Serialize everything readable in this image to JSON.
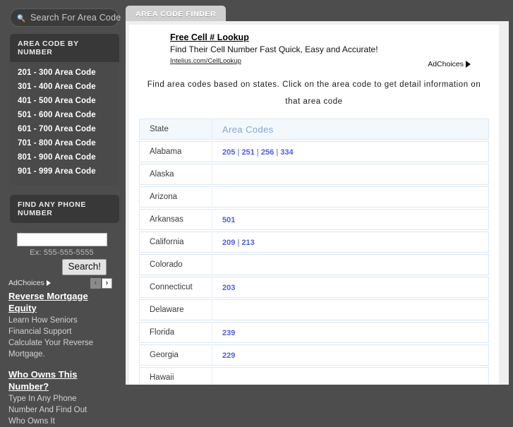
{
  "sidebar": {
    "search": {
      "icon": "search-icon",
      "placeholder": "Search For Area Code",
      "value": ""
    },
    "area_code_panel": {
      "title": "AREA CODE BY NUMBER",
      "items": [
        "201 - 300 Area Code",
        "301 - 400 Area Code",
        "401 - 500 Area Code",
        "501 - 600 Area Code",
        "601 - 700 Area Code",
        "701 - 800 Area Code",
        "801 - 900 Area Code",
        "901 - 999 Area Code"
      ]
    },
    "phone_panel": {
      "title": "FIND ANY PHONE NUMBER",
      "input_value": "",
      "hint": "Ex: 555-555-5555",
      "button_label": "Search!"
    },
    "ad_controls": {
      "adchoices_label": "AdChoices",
      "prev_label": "‹",
      "next_label": "›"
    },
    "ads": [
      {
        "title": "Reverse Mortgage Equity",
        "lines": [
          "Learn How Seniors",
          "Financial Support",
          "Calculate Your Reverse",
          "Mortgage."
        ]
      },
      {
        "title": "Who Owns This Number?",
        "lines": [
          "Type In Any Phone",
          "Number And Find Out",
          "Who Owns It"
        ]
      }
    ]
  },
  "main": {
    "tab_label": "AREA CODE FINDER",
    "ad": {
      "title": "Free Cell # Lookup",
      "description": "Find Their Cell Number Fast Quick, Easy and Accurate!",
      "url": "Intelius.com/CellLookup",
      "adchoices_label": "AdChoices"
    },
    "intro": "Find area codes based on states. Click on the area code to get detail information on that area code",
    "table": {
      "headers": [
        "State",
        "Area Codes"
      ],
      "rows": [
        {
          "state": "Alabama",
          "codes": [
            "205",
            "251",
            "256",
            "334"
          ]
        },
        {
          "state": "Alaska",
          "codes": []
        },
        {
          "state": "Arizona",
          "codes": []
        },
        {
          "state": "Arkansas",
          "codes": [
            "501"
          ]
        },
        {
          "state": "California",
          "codes": [
            "209",
            "213"
          ]
        },
        {
          "state": "Colorado",
          "codes": []
        },
        {
          "state": "Connecticut",
          "codes": [
            "203"
          ]
        },
        {
          "state": "Delaware",
          "codes": []
        },
        {
          "state": "Florida",
          "codes": [
            "239"
          ]
        },
        {
          "state": "Georgia",
          "codes": [
            "229"
          ]
        },
        {
          "state": "Hawaii",
          "codes": []
        },
        {
          "state": "",
          "codes": []
        }
      ]
    }
  },
  "colors": {
    "page_bg": "#4d4d4d",
    "panel_head": "#383838",
    "tab_bg": "#cfcfcf",
    "content_bg": "#ffffff",
    "table_border": "#dbe7f4",
    "header_row_bg": "#f3f8fd",
    "area_code_link": "#4a5ef0",
    "area_codes_header": "#7fa8d4"
  }
}
